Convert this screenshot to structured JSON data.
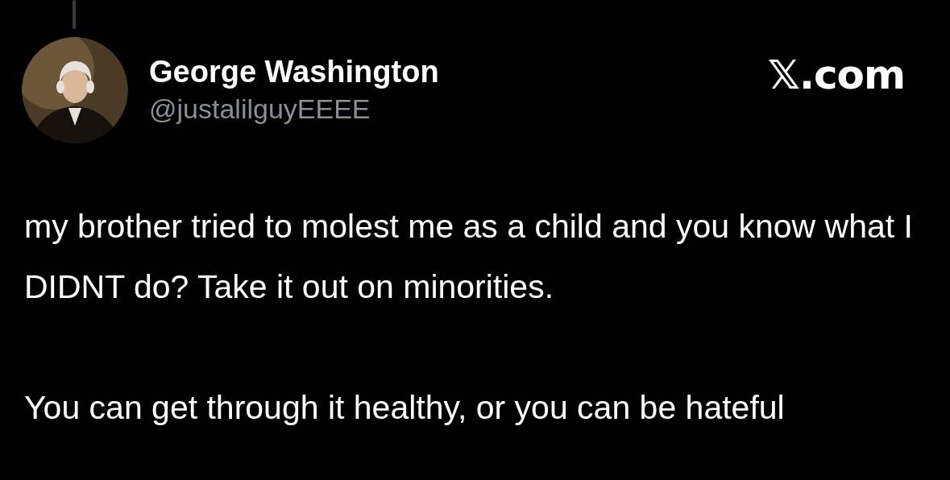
{
  "post": {
    "author": {
      "name": "George Washington",
      "handle": "@justalilguyEEEE"
    },
    "source": "𝕏.com",
    "paragraphs": [
      "my brother tried to molest me as a child and you know what I DIDNT do? Take it out on minorities.",
      "You can get through it healthy, or you can be hateful"
    ]
  }
}
